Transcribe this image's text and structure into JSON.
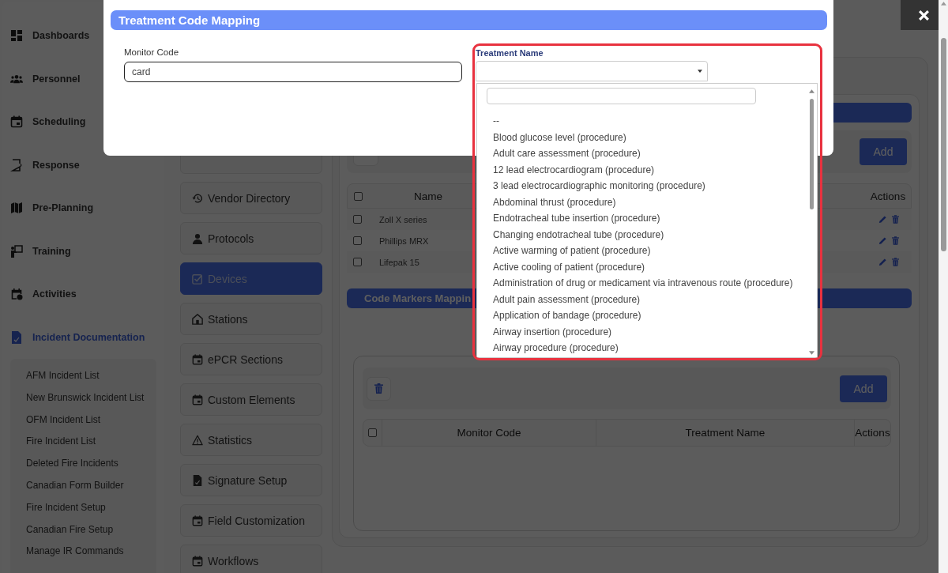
{
  "sidebar": {
    "items": [
      {
        "label": "Dashboards",
        "selected": false
      },
      {
        "label": "Personnel",
        "selected": false
      },
      {
        "label": "Scheduling",
        "selected": false
      },
      {
        "label": "Response",
        "selected": false
      },
      {
        "label": "Pre-Planning",
        "selected": false
      },
      {
        "label": "Training",
        "selected": false
      },
      {
        "label": "Activities",
        "selected": false
      },
      {
        "label": "Incident Documentation",
        "selected": true,
        "children": [
          {
            "label": "AFM Incident List"
          },
          {
            "label": "New Brunswick Incident List"
          },
          {
            "label": "OFM Incident List"
          },
          {
            "label": "Fire Incident List"
          },
          {
            "label": "Deleted Fire Incidents"
          },
          {
            "label": "Canadian Form Builder"
          },
          {
            "label": "Fire Incident Setup"
          },
          {
            "label": "Canadian Fire Setup"
          },
          {
            "label": "Manage IR Commands"
          }
        ]
      }
    ]
  },
  "settings_menu": {
    "items": [
      {
        "label": "Vendor Directory",
        "selected": false
      },
      {
        "label": "Protocols",
        "selected": false
      },
      {
        "label": "Devices",
        "selected": true
      },
      {
        "label": "Stations",
        "selected": false
      },
      {
        "label": "ePCR Sections",
        "selected": false
      },
      {
        "label": "Custom Elements",
        "selected": false
      },
      {
        "label": "Statistics",
        "selected": false
      },
      {
        "label": "Signature Setup",
        "selected": false
      },
      {
        "label": "Field Customization",
        "selected": false
      },
      {
        "label": "Workflows",
        "selected": false
      }
    ]
  },
  "devices": {
    "add_button": "Add",
    "table": {
      "all_checked": false,
      "columns": [
        {
          "label": "Name"
        },
        {
          "label": "Actions"
        }
      ],
      "rows": [
        {
          "name": "Zoll X series",
          "checked": false
        },
        {
          "name": "Phillips MRX",
          "checked": false
        },
        {
          "name": "Lifepak 15",
          "checked": false
        }
      ]
    }
  },
  "code_markers": {
    "title": "Code Markers Mappin",
    "add_button": "Add",
    "table": {
      "all_checked": false,
      "columns": [
        "Monitor Code",
        "Treatment Name",
        "Actions"
      ]
    }
  },
  "modal": {
    "title": "Treatment Code Mapping",
    "monitor_code": {
      "label": "Monitor Code",
      "value": "card"
    },
    "treatment_name": {
      "label": "Treatment Name",
      "options": [
        "--",
        "Blood glucose level (procedure)",
        "Adult care assessment (procedure)",
        "12 lead electrocardiogram (procedure)",
        "3 lead electrocardiographic monitoring (procedure)",
        "Abdominal thrust (procedure)",
        "Endotracheal tube insertion (procedure)",
        "Changing endotracheal tube (procedure)",
        "Active warming of patient (procedure)",
        "Active cooling of patient (procedure)",
        "Administration of drug or medicament via intravenous route (procedure)",
        "Adult pain assessment (procedure)",
        "Application of bandage (procedure)",
        "Airway insertion (procedure)",
        "Airway procedure (procedure)"
      ]
    }
  }
}
